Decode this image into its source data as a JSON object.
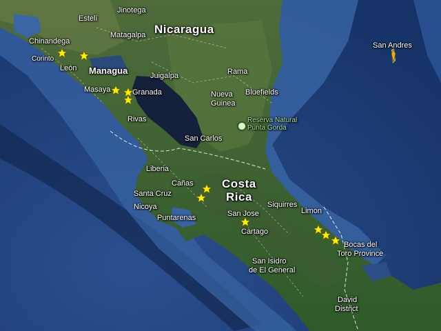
{
  "map": {
    "countries": {
      "nicaragua": "Nicaragua",
      "costa_rica_line1": "Costa",
      "costa_rica_line2": "Rica"
    },
    "cities": {
      "esteli": "Estelí",
      "jinotega": "Jinotega",
      "matagalpa": "Matagalpa",
      "chinandega": "Chinandega",
      "corinto": "Corinto",
      "leon": "León",
      "managua": "Managua",
      "juigalpa": "Juigalpa",
      "rama": "Rama",
      "masaya": "Masaya",
      "granada": "Granada",
      "nueva_guinea_1": "Nueva",
      "nueva_guinea_2": "Guinea",
      "bluefields": "Bluefields",
      "rivas": "Rivas",
      "san_carlos": "San Carlos",
      "liberia": "Liberia",
      "canas": "Cañas",
      "santa_cruz": "Santa Cruz",
      "nicoya": "Nicoya",
      "puntarenas": "Puntarenas",
      "san_jose": "San Jose",
      "cartago": "Cartago",
      "siquirres": "Siquirres",
      "limon": "Limon",
      "bocas_1": "Bocas del",
      "bocas_2": "Toro Province",
      "san_isidro_1": "San Isidro",
      "san_isidro_2": "de El General",
      "david_1": "David",
      "david_2": "District",
      "san_andres": "San Andres"
    },
    "park": {
      "line1": "Reserva Natural",
      "line2": "Punta Gorda"
    },
    "marker_color": "#ffee00",
    "marker_icon": "star-icon"
  }
}
